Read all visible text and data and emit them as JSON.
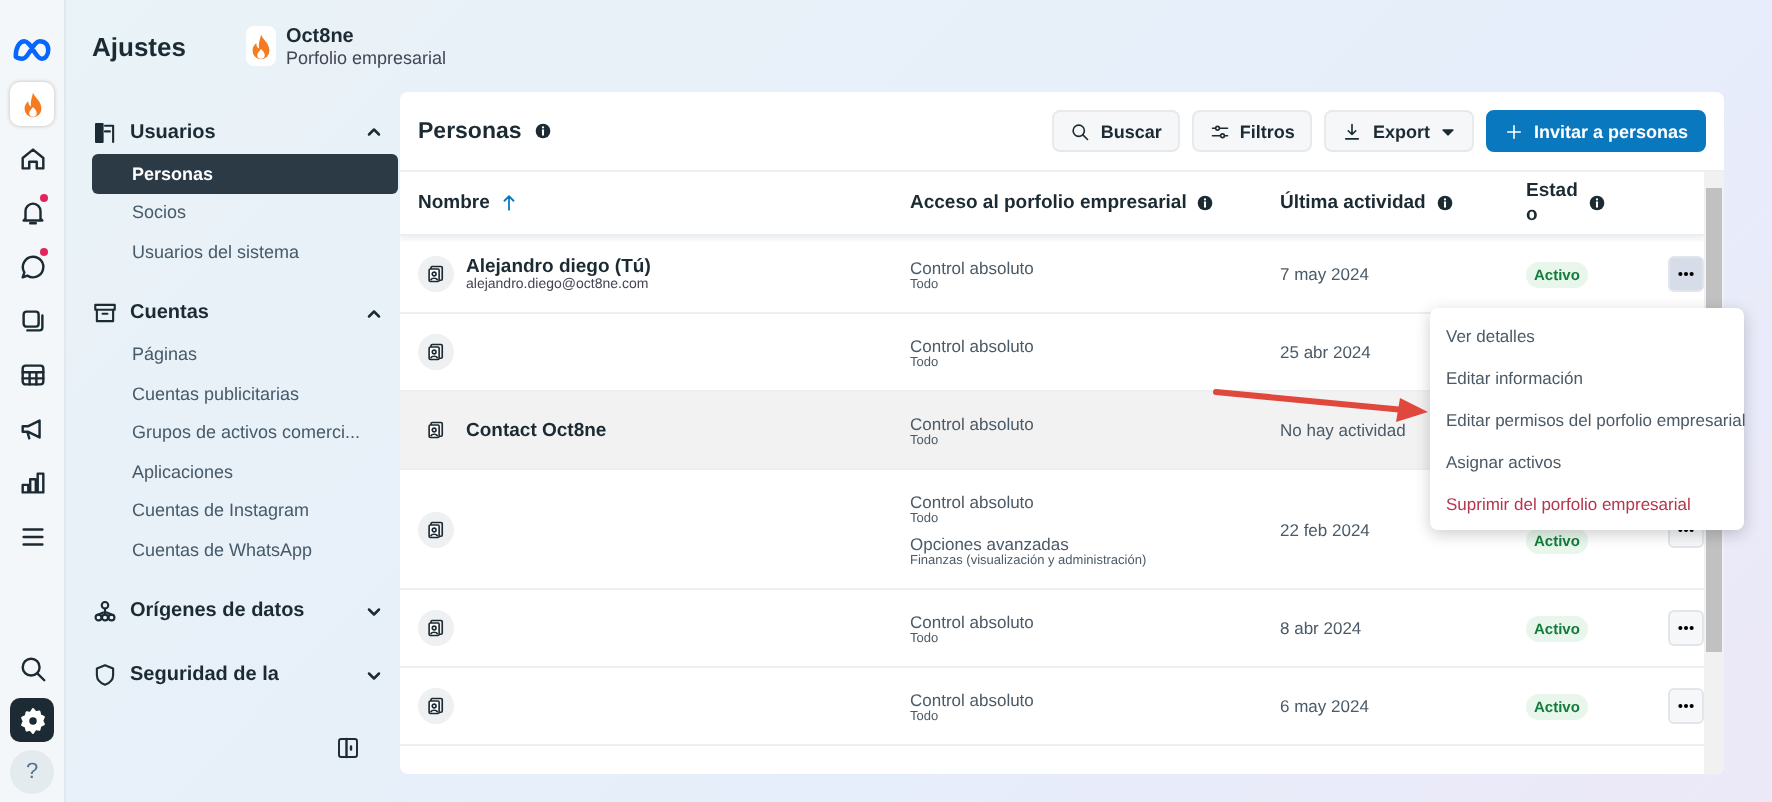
{
  "rail": {
    "items": [
      {
        "selected": false,
        "dot": false
      },
      {
        "selected": false,
        "dot": false
      },
      {
        "selected": false,
        "dot": false
      },
      {
        "selected": false,
        "dot": true
      },
      {
        "selected": false,
        "dot": true
      },
      {
        "selected": false,
        "dot": false
      },
      {
        "selected": false,
        "dot": false
      },
      {
        "selected": false,
        "dot": false
      },
      {
        "selected": false,
        "dot": false
      },
      {
        "selected": false,
        "dot": false
      }
    ],
    "bottom": [
      {
        "selected": false
      },
      {
        "selected": true
      },
      {
        "selected": false,
        "label": "?"
      }
    ]
  },
  "header": {
    "title": "Ajustes",
    "business": {
      "name": "Oct8ne",
      "subtitle": "Porfolio empresarial"
    }
  },
  "sidebar": {
    "sections": [
      {
        "label": "Usuarios",
        "expanded": true,
        "items": [
          {
            "label": "Personas",
            "selected": true
          },
          {
            "label": "Socios",
            "selected": false
          },
          {
            "label": "Usuarios del sistema",
            "selected": false
          }
        ]
      },
      {
        "label": "Cuentas",
        "expanded": true,
        "items": [
          {
            "label": "Páginas",
            "selected": false
          },
          {
            "label": "Cuentas publicitarias",
            "selected": false
          },
          {
            "label": "Grupos de activos comerci...",
            "selected": false
          },
          {
            "label": "Aplicaciones",
            "selected": false
          },
          {
            "label": "Cuentas de Instagram",
            "selected": false
          },
          {
            "label": "Cuentas de WhatsApp",
            "selected": false
          }
        ]
      },
      {
        "label": "Orígenes de datos",
        "expanded": false
      },
      {
        "label": "Seguridad de la",
        "expanded": false
      }
    ]
  },
  "panel": {
    "title": "Personas",
    "buttons": [
      {
        "label": "Buscar",
        "kind": "search"
      },
      {
        "label": "Filtros",
        "kind": "filter"
      },
      {
        "label": "Export",
        "kind": "export"
      },
      {
        "label": "Invitar a personas",
        "kind": "primary"
      }
    ],
    "table": {
      "columns": [
        "Nombre",
        "Acceso al porfolio empresarial",
        "Última actividad",
        "Estad\no"
      ],
      "rows": [
        {
          "name": "Alejandro diego (Tú)",
          "email": "alejandro.diego@oct8ne.com",
          "access": [
            {
              "title": "Control absoluto",
              "detail": "Todo"
            }
          ],
          "last": "7 may 2024",
          "status": "Activo",
          "menu": {
            "open": true
          },
          "hover": false
        },
        {
          "access": [
            {
              "title": "Control absoluto",
              "detail": "Todo"
            }
          ],
          "last": "25 abr 2024",
          "hover": false
        },
        {
          "name": "Contact Oct8ne",
          "access": [
            {
              "title": "Control absoluto",
              "detail": "Todo"
            }
          ],
          "last": "No hay actividad",
          "hover": true
        },
        {
          "access": [
            {
              "title": "Control absoluto",
              "detail": "Todo"
            },
            {
              "title": "Opciones avanzadas",
              "detail": "Finanzas (visualización y administración)"
            }
          ],
          "last": "22 feb 2024",
          "status": "Activo",
          "menu": {
            "open": false
          },
          "hover": false
        },
        {
          "access": [
            {
              "title": "Control absoluto",
              "detail": "Todo"
            }
          ],
          "last": "8 abr 2024",
          "status": "Activo",
          "menu": {
            "open": false
          },
          "hover": false
        },
        {
          "access": [
            {
              "title": "Control absoluto",
              "detail": "Todo"
            }
          ],
          "last": "6 may 2024",
          "status": "Activo",
          "menu": {
            "open": false
          },
          "hover": false
        }
      ]
    }
  },
  "context_menu": {
    "items": [
      {
        "label": "Ver detalles",
        "kind": "normal"
      },
      {
        "label": "Editar información",
        "kind": "normal"
      },
      {
        "label": "Editar permisos del porfolio empresarial",
        "kind": "normal"
      },
      {
        "label": "Asignar activos",
        "kind": "normal"
      },
      {
        "label": "Suprimir del porfolio empresarial",
        "kind": "danger"
      }
    ]
  }
}
